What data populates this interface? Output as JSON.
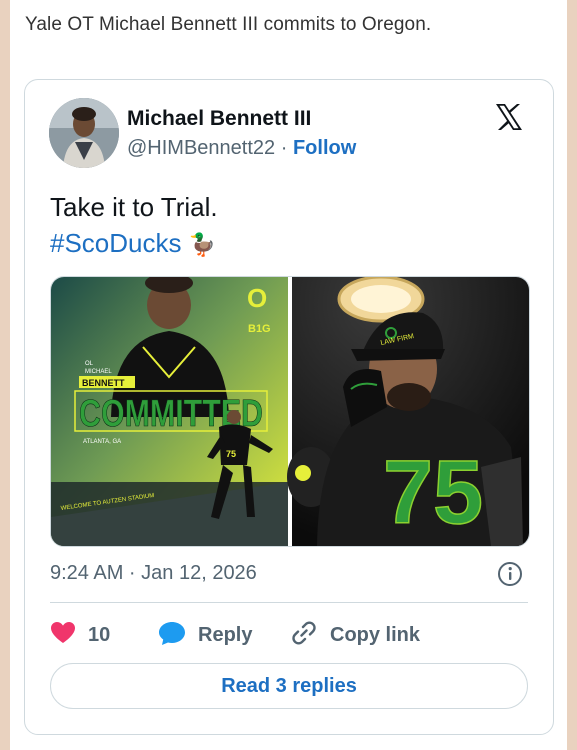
{
  "headline": "Yale OT Michael Bennett III commits to Oregon.",
  "tweet": {
    "author_name": "Michael Bennett III",
    "handle": "@HIMBennett22",
    "separator": "·",
    "follow_label": "Follow",
    "text_line1": "Take it to Trial.",
    "hashtag": "#ScoDucks",
    "emoji": "🦆",
    "timestamp": "9:24 AM · Jan 12, 2026",
    "likes_count": "10",
    "reply_label": "Reply",
    "copy_link_label": "Copy link",
    "read_replies_label": "Read 3 replies"
  },
  "media": {
    "left": {
      "logo_letter": "O",
      "conference": "B1G",
      "position_tag": "OL",
      "first_name": "MICHAEL",
      "last_name": "BENNETT",
      "status": "COMMITTED",
      "hometown": "ATLANTA, GA",
      "stadium_text": "WELCOME TO AUTZEN STADIUM"
    },
    "right": {
      "cap_text": "LAW FIRM",
      "jersey_number": "75"
    }
  },
  "colors": {
    "link": "#1d6fc2",
    "like": "#f0356b",
    "reply": "#1d9bf0",
    "oregon_yellow": "#e6ef3a",
    "oregon_green": "#2f9e3a"
  }
}
